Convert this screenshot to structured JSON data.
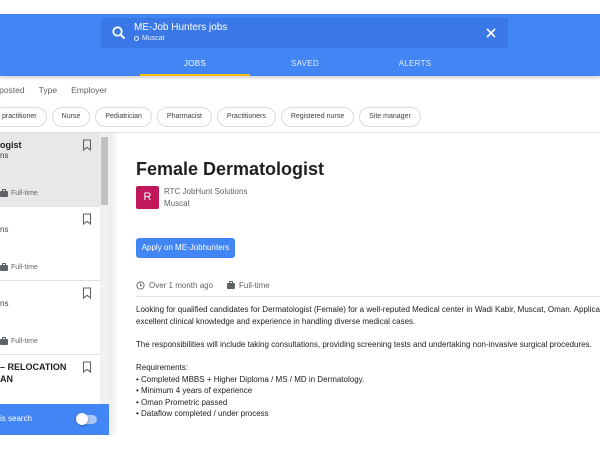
{
  "header": {
    "search_query": "ME-Job Hunters jobs",
    "search_location": "Muscat",
    "tabs": [
      {
        "label": "JOBS",
        "active": true
      },
      {
        "label": "SAVED",
        "active": false
      },
      {
        "label": "ALERTS",
        "active": false
      }
    ],
    "icons": {
      "search": "search-icon",
      "clear": "close-icon"
    },
    "accent_color": "#4285f4",
    "tab_indicator_color": "#fbbc05"
  },
  "filters": [
    "Date posted",
    "Type",
    "Employer"
  ],
  "filters_visible": [
    "e posted",
    "Type",
    "Employer"
  ],
  "chips": [
    "practitioner",
    "Nurse",
    "Pediatrician",
    "Pharmacist",
    "Practitioners",
    "Registered nurse",
    "Site manager"
  ],
  "job_list": [
    {
      "title_line1": "ogist",
      "title_line2": "",
      "company": "ns",
      "type": "Full-time"
    },
    {
      "title_line1": "",
      "title_line2": "",
      "company": "ns",
      "type": "Full-time"
    },
    {
      "title_line1": "",
      "title_line2": "",
      "company": "ns",
      "type": "Full-time"
    },
    {
      "title_line1": "– RELOCATION",
      "title_line2": "AN",
      "company": "",
      "type": ""
    }
  ],
  "alert": {
    "label": "is search",
    "enabled": false
  },
  "detail": {
    "title": "Female Dermatologist",
    "logo_letter": "R",
    "logo_color": "#c2185b",
    "company": "RTC JobHunt Solutions",
    "location": "Muscat",
    "apply_label": "Apply on ME-Jobhunters",
    "posted": "Over 1 month ago",
    "type": "Full-time",
    "description": [
      "Looking for qualified candidates for Dermatologist (Female) for a well-reputed Medical center in Wadi Kabir, Muscat, Oman. Applicant",
      "excellent clinical knowledge and experience in handling diverse medical cases.",
      "",
      "The responsibilities will include taking consultations, providing screening tests and undertaking non-invasive surgical procedures.",
      "",
      "Requirements:",
      "• Completed MBBS + Higher Diploma / MS / MD in Dermatology.",
      "• Minimum 4 years of experience",
      "• Oman Prometric passed",
      "• Dataflow completed / under process"
    ]
  }
}
